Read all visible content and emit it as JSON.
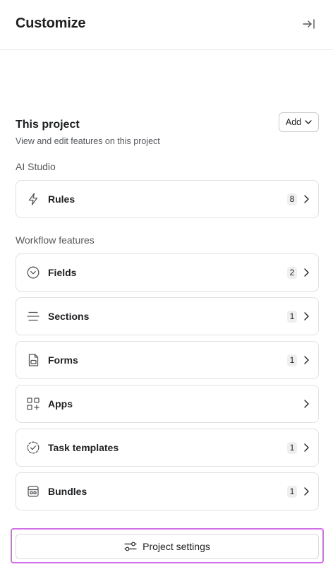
{
  "header": {
    "title": "Customize"
  },
  "project_section": {
    "title": "This project",
    "subtitle": "View and edit features on this project",
    "add_label": "Add"
  },
  "ai_studio": {
    "label": "AI Studio",
    "items": [
      {
        "label": "Rules",
        "count": "8",
        "icon": "lightning-icon"
      }
    ]
  },
  "workflow": {
    "label": "Workflow features",
    "items": [
      {
        "label": "Fields",
        "count": "2",
        "icon": "chevron-circle-icon"
      },
      {
        "label": "Sections",
        "count": "1",
        "icon": "sections-icon"
      },
      {
        "label": "Forms",
        "count": "1",
        "icon": "form-document-icon"
      },
      {
        "label": "Apps",
        "count": "",
        "icon": "apps-grid-icon"
      },
      {
        "label": "Task templates",
        "count": "1",
        "icon": "dashed-check-circle-icon"
      },
      {
        "label": "Bundles",
        "count": "1",
        "icon": "bundle-icon"
      }
    ]
  },
  "footer": {
    "settings_label": "Project settings",
    "highlight_color": "#d26ee8"
  }
}
